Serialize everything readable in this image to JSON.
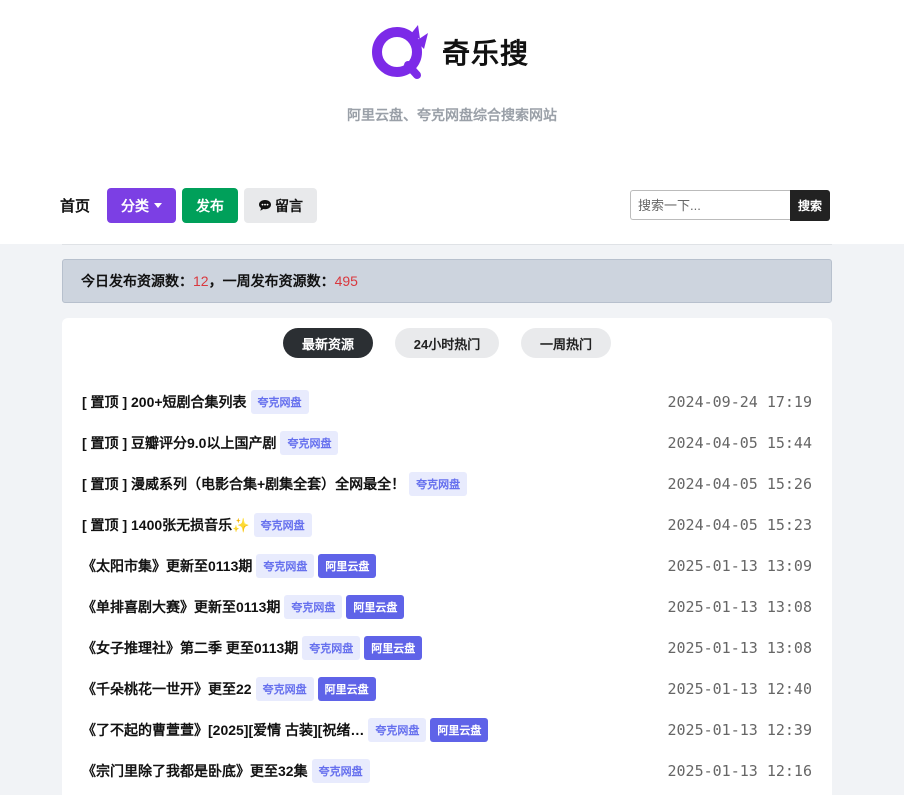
{
  "site": {
    "name": "奇乐搜",
    "tagline": "阿里云盘、夸克网盘综合搜索网站",
    "logo_color": "#7c2ae8"
  },
  "nav": {
    "home": "首页",
    "category": "分类",
    "publish": "发布",
    "message": "留言",
    "message_icon": "speech-bubble-icon"
  },
  "search": {
    "placeholder": "搜索一下...",
    "button": "搜索"
  },
  "stats": {
    "today_label": "今日发布资源数：",
    "today_count": "12",
    "separator": "，",
    "week_label": "一周发布资源数：",
    "week_count": "495"
  },
  "tabs": [
    "最新资源",
    "24小时热门",
    "一周热门"
  ],
  "resources": [
    {
      "title": "[ 置顶 ] 200+短剧合集列表",
      "tags": [
        "夸克网盘"
      ],
      "time": "2024-09-24 17:19"
    },
    {
      "title": "[ 置顶 ] 豆瓣评分9.0以上国产剧",
      "tags": [
        "夸克网盘"
      ],
      "time": "2024-04-05 15:44"
    },
    {
      "title": "[ 置顶 ] 漫威系列（电影合集+剧集全套）全网最全！",
      "tags": [
        "夸克网盘"
      ],
      "time": "2024-04-05 15:26"
    },
    {
      "title": "[ 置顶 ] 1400张无损音乐✨",
      "tags": [
        "夸克网盘"
      ],
      "time": "2024-04-05 15:23"
    },
    {
      "title": "《太阳市集》更新至0113期",
      "tags": [
        "夸克网盘",
        "阿里云盘"
      ],
      "time": "2025-01-13 13:09"
    },
    {
      "title": "《单排喜剧大赛》更新至0113期",
      "tags": [
        "夸克网盘",
        "阿里云盘"
      ],
      "time": "2025-01-13 13:08"
    },
    {
      "title": "《女子推理社》第二季 更至0113期",
      "tags": [
        "夸克网盘",
        "阿里云盘"
      ],
      "time": "2025-01-13 13:08"
    },
    {
      "title": "《千朵桃花一世开》更至22",
      "tags": [
        "夸克网盘",
        "阿里云盘"
      ],
      "time": "2025-01-13 12:40"
    },
    {
      "title": "《了不起的曹萱萱》[2025][爱情 古装][祝绪…",
      "tags": [
        "夸克网盘",
        "阿里云盘"
      ],
      "time": "2025-01-13 12:39"
    },
    {
      "title": "《宗门里除了我都是卧底》更至32集",
      "tags": [
        "夸克网盘"
      ],
      "time": "2025-01-13 12:16"
    }
  ]
}
